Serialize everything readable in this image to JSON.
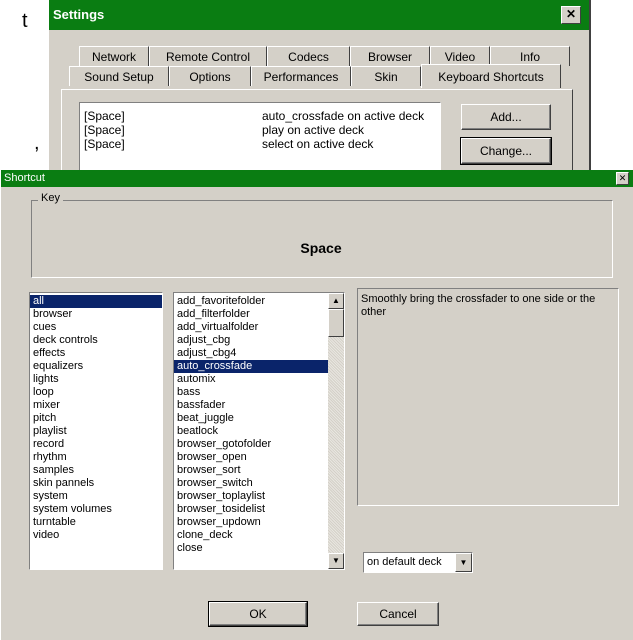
{
  "background": {
    "top_letter": "t",
    "comma": ","
  },
  "settings": {
    "title": "Settings",
    "close_glyph": "✕",
    "tabs_row1": [
      "Network",
      "Remote Control",
      "Codecs",
      "Browser",
      "Video",
      "Info"
    ],
    "tabs_row2": [
      "Sound Setup",
      "Options",
      "Performances",
      "Skin",
      "Keyboard Shortcuts"
    ],
    "active_tab": "Keyboard Shortcuts",
    "shortcuts": [
      {
        "key": "[Space]",
        "action": "auto_crossfade on active deck"
      },
      {
        "key": "[Space]",
        "action": "play on active deck"
      },
      {
        "key": "[Space]",
        "action": "select on active deck"
      }
    ],
    "add_label": "Add...",
    "change_label": "Change..."
  },
  "shortcut": {
    "title": "Shortcut",
    "close_glyph": "✕",
    "key_legend": "Key",
    "key_value": "Space",
    "categories": [
      "all",
      "browser",
      "cues",
      "deck controls",
      "effects",
      "equalizers",
      "lights",
      "loop",
      "mixer",
      "pitch",
      "playlist",
      "record",
      "rhythm",
      "samples",
      "skin pannels",
      "system",
      "system volumes",
      "turntable",
      "video"
    ],
    "selected_category": "all",
    "actions": [
      "add_favoritefolder",
      "add_filterfolder",
      "add_virtualfolder",
      "adjust_cbg",
      "adjust_cbg4",
      "auto_crossfade",
      "automix",
      "bass",
      "bassfader",
      "beat_juggle",
      "beatlock",
      "browser_gotofolder",
      "browser_open",
      "browser_sort",
      "browser_switch",
      "browser_toplaylist",
      "browser_tosidelist",
      "browser_updown",
      "clone_deck",
      "close"
    ],
    "selected_action": "auto_crossfade",
    "description": "Smoothly bring the crossfader to one side or the other",
    "deck_option": "on default deck",
    "ok_label": "OK",
    "cancel_label": "Cancel"
  }
}
